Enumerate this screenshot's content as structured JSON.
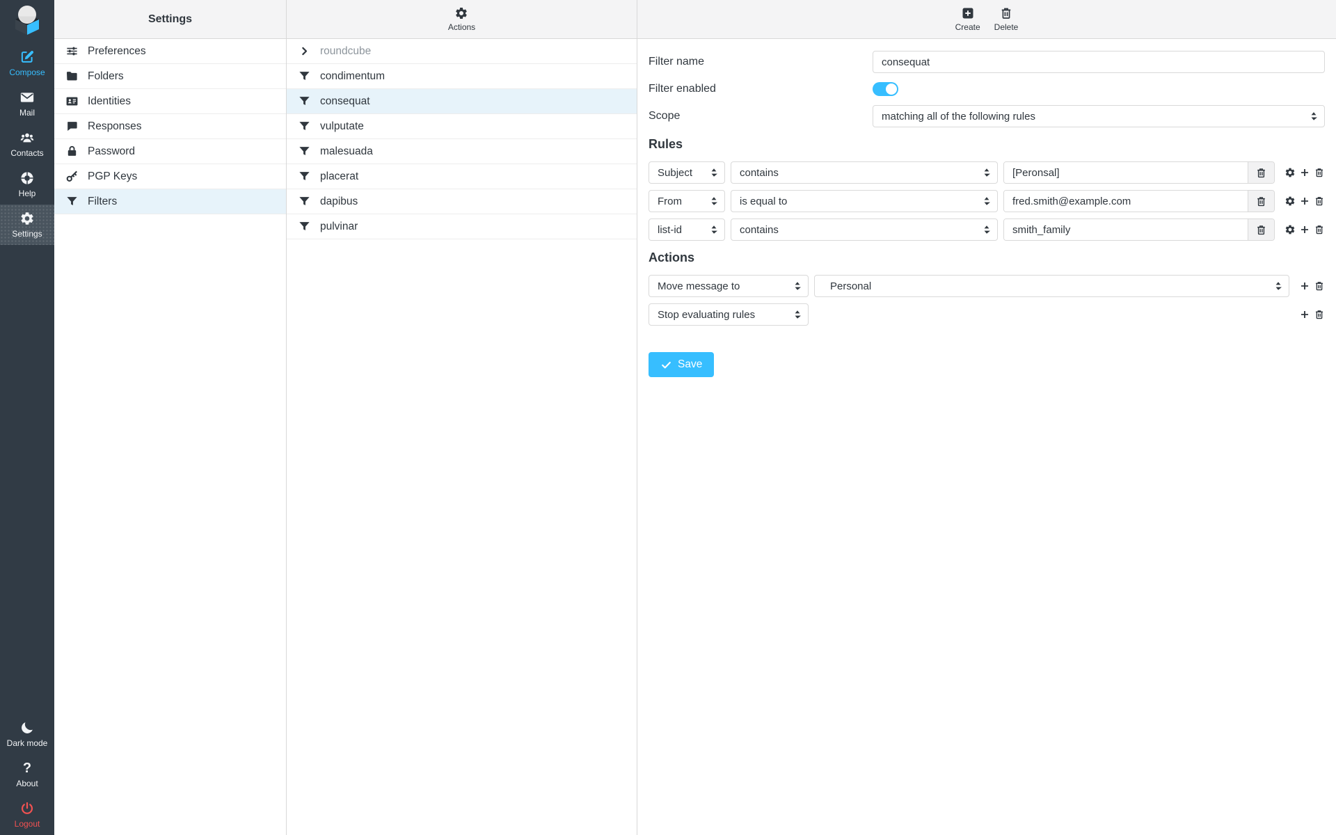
{
  "colors": {
    "accent": "#37beff",
    "sidebar_bg": "#313b45",
    "selection_bg": "#e7f3fa",
    "logout_red": "#f25252"
  },
  "sidebar": {
    "items": [
      {
        "label": "Compose"
      },
      {
        "label": "Mail"
      },
      {
        "label": "Contacts"
      },
      {
        "label": "Help"
      },
      {
        "label": "Settings"
      }
    ],
    "bottom_items": [
      {
        "label": "Dark mode"
      },
      {
        "label": "About"
      },
      {
        "label": "Logout"
      }
    ]
  },
  "settings_panel": {
    "title": "Settings",
    "items": [
      {
        "label": "Preferences"
      },
      {
        "label": "Folders"
      },
      {
        "label": "Identities"
      },
      {
        "label": "Responses"
      },
      {
        "label": "Password"
      },
      {
        "label": "PGP Keys"
      },
      {
        "label": "Filters"
      }
    ]
  },
  "filters_panel": {
    "header_label": "Actions",
    "filter_set": {
      "label": "roundcube"
    },
    "filters": [
      {
        "label": "condimentum"
      },
      {
        "label": "consequat"
      },
      {
        "label": "vulputate"
      },
      {
        "label": "malesuada"
      },
      {
        "label": "placerat"
      },
      {
        "label": "dapibus"
      },
      {
        "label": "pulvinar"
      }
    ]
  },
  "content": {
    "header": {
      "create_label": "Create",
      "delete_label": "Delete"
    },
    "form": {
      "filter_name": {
        "label": "Filter name",
        "value": "consequat"
      },
      "filter_enabled": {
        "label": "Filter enabled",
        "enabled": true
      },
      "scope": {
        "label": "Scope",
        "value": "matching all of the following rules"
      },
      "rules_heading": "Rules",
      "rules": [
        {
          "field": "Subject",
          "operator": "contains",
          "value": "[Peronsal]"
        },
        {
          "field": "From",
          "operator": "is equal to",
          "value": "fred.smith@example.com"
        },
        {
          "field": "list-id",
          "operator": "contains",
          "value": "smith_family"
        }
      ],
      "actions_heading": "Actions",
      "actions": [
        {
          "type": "Move message to",
          "target": "Personal"
        },
        {
          "type": "Stop evaluating rules"
        }
      ],
      "save_label": "Save"
    }
  }
}
